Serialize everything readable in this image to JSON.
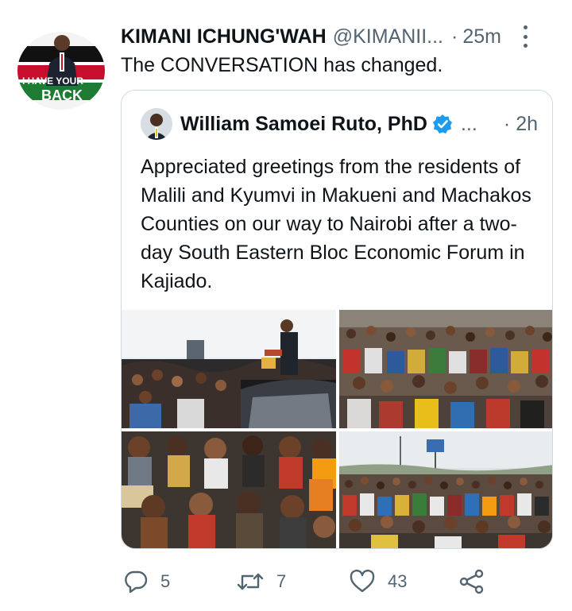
{
  "tweet": {
    "author_name": "KIMANI ICHUNG'WAH",
    "handle": "@KIMANII...",
    "separator": "·",
    "time": "25m",
    "text": "The CONVERSATION has changed.",
    "avatar_text_top": "I HAVE YOUR",
    "avatar_text_bottom": "BACK",
    "avatar_colors": {
      "black": "#111111",
      "red": "#c8102e",
      "green": "#1e7b34"
    }
  },
  "quoted": {
    "author_name": "William Samoei Ruto, PhD",
    "ellipsis": "...",
    "separator": "·",
    "time": "2h",
    "text": "Appreciated greetings from the residents of Malili and Kyumvi in Makueni and Machakos Counties on our way to Nairobi after a two-day South Eastern Bloc Economic Forum in Kajiado.",
    "verified_color": "#1d9bf0",
    "photos": [
      "crowd-photo-1",
      "crowd-photo-2",
      "crowd-photo-3",
      "crowd-photo-4"
    ]
  },
  "actions": {
    "reply_count": "5",
    "retweet_count": "7",
    "like_count": "43",
    "icons": [
      "reply-icon",
      "retweet-icon",
      "like-icon",
      "share-icon"
    ]
  }
}
